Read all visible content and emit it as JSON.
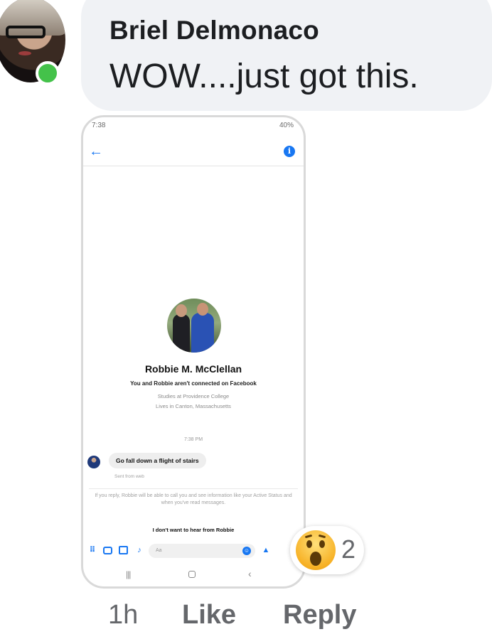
{
  "comment": {
    "author": "Briel Delmonaco",
    "text": "WOW....just got this.",
    "time": "1h",
    "like_label": "Like",
    "reply_label": "Reply",
    "reaction_icon": "wow-emoji",
    "reaction_count": "2",
    "online_status_color": "#44c24a"
  },
  "phone": {
    "status_left": "7:38",
    "status_right": "40%",
    "profile": {
      "name": "Robbie M. McClellan",
      "connection": "You and Robbie aren't connected on Facebook",
      "studies": "Studies at Providence College",
      "lives": "Lives in Canton, Massachusetts"
    },
    "timestamp": "7:38 PM",
    "message": "Go fall down a flight of stairs",
    "sent_from": "Sent from web",
    "reply_notice": "If you reply, Robbie will be able to call you and see information like your Active Status and when you've read messages.",
    "dont_want": "I don't want to hear from Robbie",
    "input_placeholder": "Aa",
    "accent_color": "#1877f2"
  }
}
